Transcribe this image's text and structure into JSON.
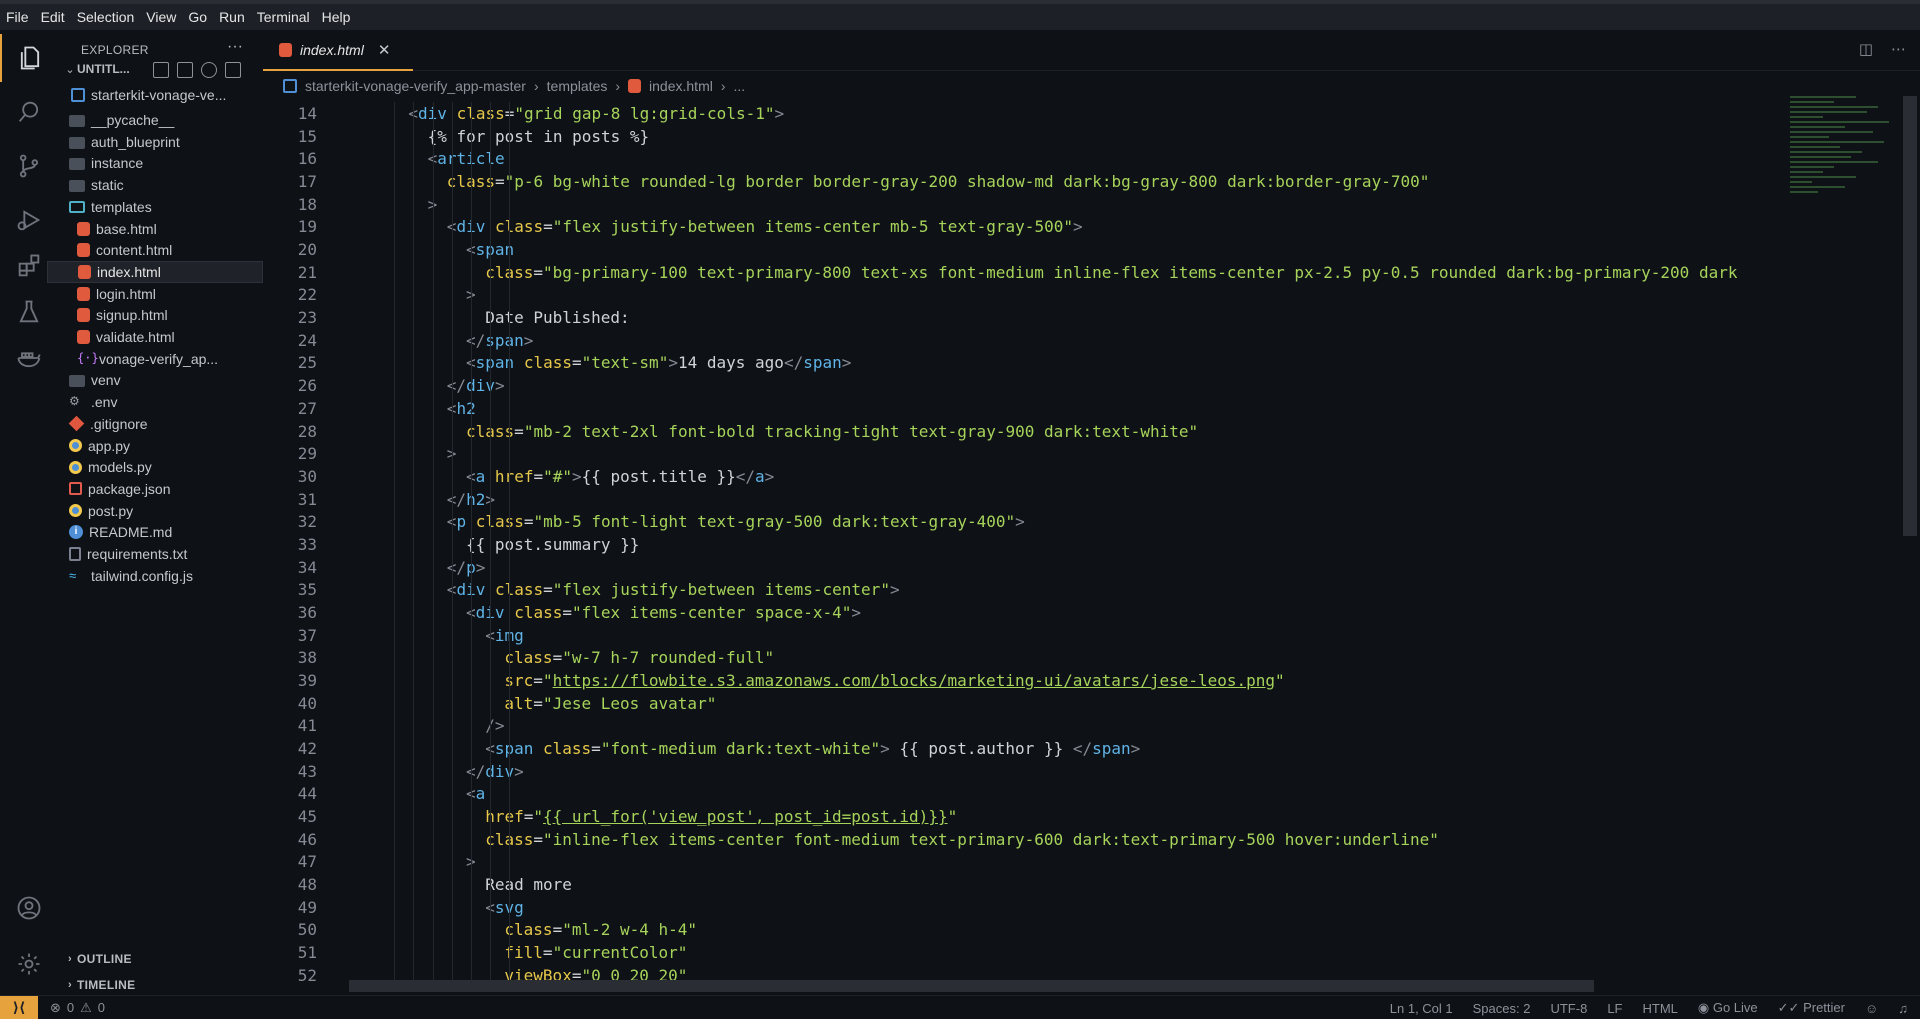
{
  "menu": [
    "File",
    "Edit",
    "Selection",
    "View",
    "Go",
    "Run",
    "Terminal",
    "Help"
  ],
  "activity_icons": [
    "files-icon",
    "search-icon",
    "source-control-icon",
    "run-debug-icon",
    "extensions-icon",
    "testing-icon",
    "docker-icon"
  ],
  "explorer": {
    "title": "EXPLORER",
    "more": "···",
    "workspace": "UNTITL...",
    "root": "starterkit-vonage-ve...",
    "items": [
      {
        "label": "__pycache__",
        "kind": "folder",
        "indent": 1
      },
      {
        "label": "auth_blueprint",
        "kind": "folder",
        "indent": 1
      },
      {
        "label": "instance",
        "kind": "folder",
        "indent": 1
      },
      {
        "label": "static",
        "kind": "folder",
        "indent": 1
      },
      {
        "label": "templates",
        "kind": "folder-open",
        "indent": 1
      },
      {
        "label": "base.html",
        "kind": "html",
        "indent": 2
      },
      {
        "label": "content.html",
        "kind": "html",
        "indent": 2
      },
      {
        "label": "index.html",
        "kind": "html",
        "indent": 2,
        "selected": true
      },
      {
        "label": "login.html",
        "kind": "html",
        "indent": 2
      },
      {
        "label": "signup.html",
        "kind": "html",
        "indent": 2
      },
      {
        "label": "validate.html",
        "kind": "html",
        "indent": 2
      },
      {
        "label": "vonage-verify_ap...",
        "kind": "json",
        "indent": 2
      },
      {
        "label": "venv",
        "kind": "folder",
        "indent": 1
      },
      {
        "label": ".env",
        "kind": "env",
        "indent": 1
      },
      {
        "label": ".gitignore",
        "kind": "git",
        "indent": 1
      },
      {
        "label": "app.py",
        "kind": "py",
        "indent": 1
      },
      {
        "label": "models.py",
        "kind": "py",
        "indent": 1
      },
      {
        "label": "package.json",
        "kind": "pkg",
        "indent": 1
      },
      {
        "label": "post.py",
        "kind": "py",
        "indent": 1
      },
      {
        "label": "README.md",
        "kind": "info",
        "indent": 1
      },
      {
        "label": "requirements.txt",
        "kind": "txt",
        "indent": 1
      },
      {
        "label": "tailwind.config.js",
        "kind": "tw",
        "indent": 1
      }
    ],
    "outline": "OUTLINE",
    "timeline": "TIMELINE"
  },
  "tab": {
    "label": "index.html",
    "close": "✕"
  },
  "breadcrumb": [
    "starterkit-vonage-verify_app-master",
    "templates",
    "index.html",
    "..."
  ],
  "code": [
    {
      "n": "14",
      "indent": 2,
      "html": "<span class=\"g\">&lt;</span><span class=\"t\">div</span> <span class=\"a\">class</span><span class=\"p\">=</span><span class=\"s\">\"grid gap-8 lg:grid-cols-1\"</span><span class=\"g\">&gt;</span>"
    },
    {
      "n": "15",
      "indent": 3,
      "html": "<span class=\"p\">{% for post in posts %}</span>"
    },
    {
      "n": "16",
      "indent": 3,
      "html": "<span class=\"g\">&lt;</span><span class=\"t\">article</span>"
    },
    {
      "n": "17",
      "indent": 4,
      "html": "<span class=\"a\">class</span><span class=\"p\">=</span><span class=\"s\">\"p-6 bg-white rounded-lg border border-gray-200 shadow-md dark:bg-gray-800 dark:border-gray-700\"</span>"
    },
    {
      "n": "18",
      "indent": 3,
      "html": "<span class=\"g\">&gt;</span>"
    },
    {
      "n": "19",
      "indent": 4,
      "html": "<span class=\"g\">&lt;</span><span class=\"t\">div</span> <span class=\"a\">class</span><span class=\"p\">=</span><span class=\"s\">\"flex justify-between items-center mb-5 text-gray-500\"</span><span class=\"g\">&gt;</span>"
    },
    {
      "n": "20",
      "indent": 5,
      "html": "<span class=\"g\">&lt;</span><span class=\"t\">span</span>"
    },
    {
      "n": "21",
      "indent": 6,
      "html": "<span class=\"a\">class</span><span class=\"p\">=</span><span class=\"s\">\"bg-primary-100 text-primary-800 text-xs font-medium inline-flex items-center px-2.5 py-0.5 rounded dark:bg-primary-200 dark</span>"
    },
    {
      "n": "22",
      "indent": 5,
      "html": "<span class=\"g\">&gt;</span>"
    },
    {
      "n": "23",
      "indent": 6,
      "html": "<span class=\"p\">Date Published:</span>"
    },
    {
      "n": "24",
      "indent": 5,
      "html": "<span class=\"g\">&lt;/</span><span class=\"t\">span</span><span class=\"g\">&gt;</span>"
    },
    {
      "n": "25",
      "indent": 5,
      "html": "<span class=\"g\">&lt;</span><span class=\"t\">span</span> <span class=\"a\">class</span><span class=\"p\">=</span><span class=\"s\">\"text-sm\"</span><span class=\"g\">&gt;</span><span class=\"p\">14 days ago</span><span class=\"g\">&lt;/</span><span class=\"t\">span</span><span class=\"g\">&gt;</span>"
    },
    {
      "n": "26",
      "indent": 4,
      "html": "<span class=\"g\">&lt;/</span><span class=\"t\">div</span><span class=\"g\">&gt;</span>"
    },
    {
      "n": "27",
      "indent": 4,
      "html": "<span class=\"g\">&lt;</span><span class=\"t\">h2</span>"
    },
    {
      "n": "28",
      "indent": 5,
      "html": "<span class=\"a\">class</span><span class=\"p\">=</span><span class=\"s\">\"mb-2 text-2xl font-bold tracking-tight text-gray-900 dark:text-white\"</span>"
    },
    {
      "n": "29",
      "indent": 4,
      "html": "<span class=\"g\">&gt;</span>"
    },
    {
      "n": "30",
      "indent": 5,
      "html": "<span class=\"g\">&lt;</span><span class=\"t\">a</span> <span class=\"a\">href</span><span class=\"p\">=</span><span class=\"s\">\"#\"</span><span class=\"g\">&gt;</span><span class=\"p\">{{ post.title }}</span><span class=\"g\">&lt;/</span><span class=\"t\">a</span><span class=\"g\">&gt;</span>"
    },
    {
      "n": "31",
      "indent": 4,
      "html": "<span class=\"g\">&lt;/</span><span class=\"t\">h2</span><span class=\"g\">&gt;</span>"
    },
    {
      "n": "32",
      "indent": 4,
      "html": "<span class=\"g\">&lt;</span><span class=\"t\">p</span> <span class=\"a\">class</span><span class=\"p\">=</span><span class=\"s\">\"mb-5 font-light text-gray-500 dark:text-gray-400\"</span><span class=\"g\">&gt;</span>"
    },
    {
      "n": "33",
      "indent": 5,
      "html": "<span class=\"p\">{{ post.summary }}</span>"
    },
    {
      "n": "34",
      "indent": 4,
      "html": "<span class=\"g\">&lt;/</span><span class=\"t\">p</span><span class=\"g\">&gt;</span>"
    },
    {
      "n": "35",
      "indent": 4,
      "html": "<span class=\"g\">&lt;</span><span class=\"t\">div</span> <span class=\"a\">class</span><span class=\"p\">=</span><span class=\"s\">\"flex justify-between items-center\"</span><span class=\"g\">&gt;</span>"
    },
    {
      "n": "36",
      "indent": 5,
      "html": "<span class=\"g\">&lt;</span><span class=\"t\">div</span> <span class=\"a\">class</span><span class=\"p\">=</span><span class=\"s\">\"flex items-center space-x-4\"</span><span class=\"g\">&gt;</span>"
    },
    {
      "n": "37",
      "indent": 6,
      "html": "<span class=\"g\">&lt;</span><span class=\"t\">img</span>"
    },
    {
      "n": "38",
      "indent": 7,
      "html": "<span class=\"a\">class</span><span class=\"p\">=</span><span class=\"s\">\"w-7 h-7 rounded-full\"</span>"
    },
    {
      "n": "39",
      "indent": 7,
      "html": "<span class=\"a\">src</span><span class=\"p\">=</span><span class=\"s\">\"</span><span class=\"u\">https://flowbite.s3.amazonaws.com/blocks/marketing-ui/avatars/jese-leos.png</span><span class=\"s\">\"</span>"
    },
    {
      "n": "40",
      "indent": 7,
      "html": "<span class=\"a\">alt</span><span class=\"p\">=</span><span class=\"s\">\"Jese Leos avatar\"</span>"
    },
    {
      "n": "41",
      "indent": 6,
      "html": "<span class=\"g\">/&gt;</span>"
    },
    {
      "n": "42",
      "indent": 6,
      "html": "<span class=\"g\">&lt;</span><span class=\"t\">span</span> <span class=\"a\">class</span><span class=\"p\">=</span><span class=\"s\">\"font-medium dark:text-white\"</span><span class=\"g\">&gt;</span><span class=\"p\"> {{ post.author }} </span><span class=\"g\">&lt;/</span><span class=\"t\">span</span><span class=\"g\">&gt;</span>"
    },
    {
      "n": "43",
      "indent": 5,
      "html": "<span class=\"g\">&lt;/</span><span class=\"t\">div</span><span class=\"g\">&gt;</span>"
    },
    {
      "n": "44",
      "indent": 5,
      "html": "<span class=\"g\">&lt;</span><span class=\"t\">a</span>"
    },
    {
      "n": "45",
      "indent": 6,
      "html": "<span class=\"a\">href</span><span class=\"p\">=</span><span class=\"s\">\"</span><span class=\"u\">{{ url_for('view_post', post_id=post.id)}}</span><span class=\"s\">\"</span>"
    },
    {
      "n": "46",
      "indent": 6,
      "html": "<span class=\"a\">class</span><span class=\"p\">=</span><span class=\"s\">\"inline-flex items-center font-medium text-primary-600 dark:text-primary-500 hover:underline\"</span>"
    },
    {
      "n": "47",
      "indent": 5,
      "html": "<span class=\"g\">&gt;</span>"
    },
    {
      "n": "48",
      "indent": 6,
      "html": "<span class=\"p\">Read more</span>"
    },
    {
      "n": "49",
      "indent": 6,
      "html": "<span class=\"g\">&lt;</span><span class=\"t\">svg</span>"
    },
    {
      "n": "50",
      "indent": 7,
      "html": "<span class=\"a\">class</span><span class=\"p\">=</span><span class=\"s\">\"ml-2 w-4 h-4\"</span>"
    },
    {
      "n": "51",
      "indent": 7,
      "html": "<span class=\"a\">fill</span><span class=\"p\">=</span><span class=\"s\">\"currentColor\"</span>"
    },
    {
      "n": "52",
      "indent": 7,
      "html": "<span class=\"a\">viewBox</span><span class=\"p\">=</span><span class=\"s\">\"0 0 20 20\"</span>"
    }
  ],
  "status": {
    "errors": "0",
    "warnings": "0",
    "position": "Ln 1, Col 1",
    "spaces": "Spaces: 2",
    "encoding": "UTF-8",
    "eol": "LF",
    "language": "HTML",
    "golive": "Go Live",
    "prettier": "Prettier"
  },
  "colors": {
    "accent": "#e6a23c",
    "background": "#0e1116",
    "tag": "#5fb3e6",
    "attr": "#e6c84a",
    "string": "#a6d35a"
  }
}
